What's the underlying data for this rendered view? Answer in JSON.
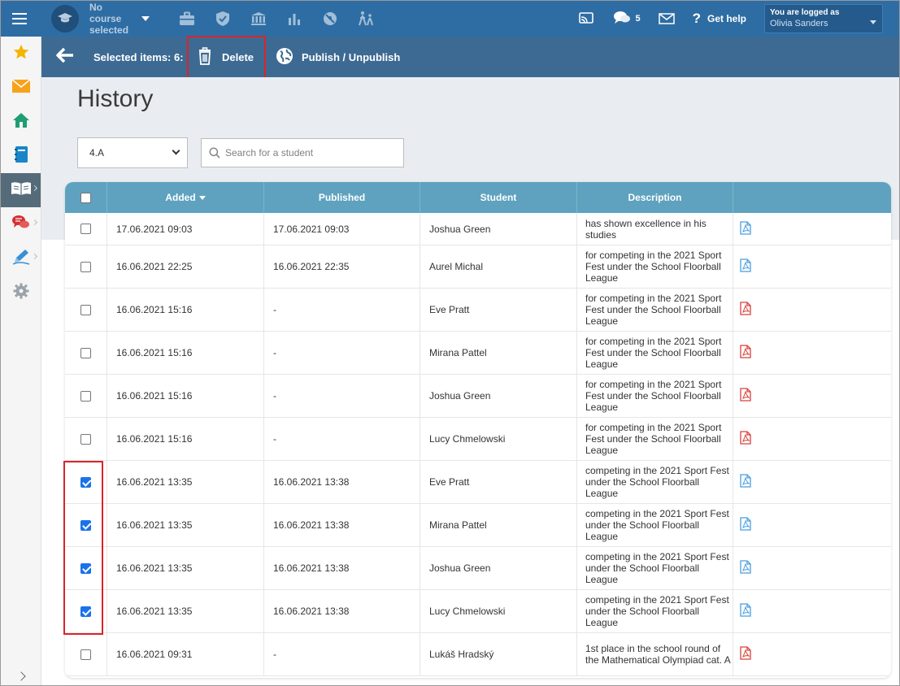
{
  "topbar": {
    "course_line1": "No course",
    "course_line2": "selected",
    "messages_count": "5",
    "help_label": "Get help",
    "logged_as_label": "You are logged as",
    "user_name": "Olivia Sanders"
  },
  "actionbar": {
    "selected_label": "Selected items: 6:",
    "delete_label": "Delete",
    "publish_label": "Publish / Unpublish"
  },
  "page": {
    "title": "History",
    "class_value": "4.A",
    "search_placeholder": "Search for a student"
  },
  "table": {
    "headers": {
      "added": "Added",
      "published": "Published",
      "student": "Student",
      "description": "Description"
    },
    "rows": [
      {
        "added": "17.06.2021 09:03",
        "published": "17.06.2021 09:03",
        "student": "Joshua Green",
        "description": "has shown excellence in his studies",
        "checked": false,
        "pdf": "blue"
      },
      {
        "added": "16.06.2021 22:25",
        "published": "16.06.2021 22:35",
        "student": "Aurel Michal",
        "description": "for competing in the 2021 Sport Fest under the School Floorball League",
        "checked": false,
        "pdf": "blue"
      },
      {
        "added": "16.06.2021 15:16",
        "published": "-",
        "student": "Eve Pratt",
        "description": "for competing in the 2021 Sport Fest under the School Floorball League",
        "checked": false,
        "pdf": "red"
      },
      {
        "added": "16.06.2021 15:16",
        "published": "-",
        "student": "Mirana Pattel",
        "description": "for competing in the 2021 Sport Fest under the School Floorball League",
        "checked": false,
        "pdf": "red"
      },
      {
        "added": "16.06.2021 15:16",
        "published": "-",
        "student": "Joshua Green",
        "description": "for competing in the 2021 Sport Fest under the School Floorball League",
        "checked": false,
        "pdf": "red"
      },
      {
        "added": "16.06.2021 15:16",
        "published": "-",
        "student": "Lucy Chmelowski",
        "description": "for competing in the 2021 Sport Fest under the School Floorball League",
        "checked": false,
        "pdf": "red"
      },
      {
        "added": "16.06.2021 13:35",
        "published": "16.06.2021 13:38",
        "student": "Eve Pratt",
        "description": "competing in the 2021 Sport Fest under the School Floorball League",
        "checked": true,
        "pdf": "blue"
      },
      {
        "added": "16.06.2021 13:35",
        "published": "16.06.2021 13:38",
        "student": "Mirana Pattel",
        "description": "competing in the 2021 Sport Fest under the School Floorball League",
        "checked": true,
        "pdf": "blue"
      },
      {
        "added": "16.06.2021 13:35",
        "published": "16.06.2021 13:38",
        "student": "Joshua Green",
        "description": "competing in the 2021 Sport Fest under the School Floorball League",
        "checked": true,
        "pdf": "blue"
      },
      {
        "added": "16.06.2021 13:35",
        "published": "16.06.2021 13:38",
        "student": "Lucy Chmelowski",
        "description": "competing in the 2021 Sport Fest under the School Floorball League",
        "checked": true,
        "pdf": "blue"
      },
      {
        "added": "16.06.2021 09:31",
        "published": "-",
        "student": "Lukáš Hradský",
        "description": "1st place in the school round of the Mathematical Olympiad cat. A",
        "checked": false,
        "pdf": "red"
      }
    ]
  },
  "colors": {
    "topbar": "#2e6da4",
    "actionbar": "#3d6a93",
    "table_header": "#5ea2bf",
    "highlight": "#d9252a",
    "pdf_blue": "#4a9ee0",
    "pdf_red": "#d9403a"
  },
  "icons": {
    "menu": "hamburger-icon",
    "course": "graduation-cap-icon",
    "top": [
      "briefcase-icon",
      "shield-check-icon",
      "bank-icon",
      "bar-chart-icon",
      "no-entry-icon",
      "walking-kids-icon"
    ],
    "right": [
      "cast-icon",
      "chat-icon",
      "mail-icon",
      "help-icon"
    ],
    "sidebar": [
      "star-icon",
      "mail-icon",
      "home-icon",
      "notebook-icon",
      "open-book-icon",
      "speech-bubbles-icon",
      "pen-icon",
      "gear-icon"
    ]
  }
}
